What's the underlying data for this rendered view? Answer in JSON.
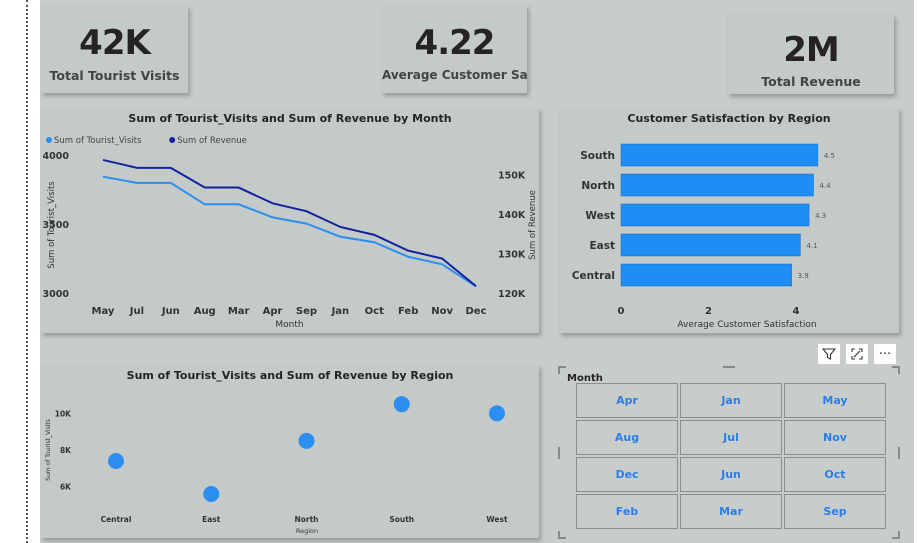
{
  "kpis": [
    {
      "value": "42K",
      "label": "Total Tourist Visits"
    },
    {
      "value": "4.22",
      "label": "Average Customer Sat..."
    },
    {
      "value": "2M",
      "label": "Total Revenue"
    }
  ],
  "chart_data": [
    {
      "type": "line",
      "title": "Sum of Tourist_Visits and Sum of Revenue by Month",
      "xlabel": "Month",
      "ylabel": "Sum of Tourist_Visits",
      "y2label": "Sum of Revenue",
      "x": [
        "May",
        "Jul",
        "Jun",
        "Aug",
        "Mar",
        "Apr",
        "Sep",
        "Jan",
        "Oct",
        "Feb",
        "Nov",
        "Dec"
      ],
      "ylim": [
        3000,
        4000
      ],
      "y2lim": [
        120000,
        155000
      ],
      "yticks": [
        "4000",
        "3500",
        "3000"
      ],
      "y2ticks": [
        "150K",
        "140K",
        "130K",
        "120K"
      ],
      "legend_position": "top-left",
      "series": [
        {
          "name": "Sum of Tourist_Visits",
          "axis": "left",
          "color": "#2b8ef0",
          "values": [
            3850,
            3805,
            3805,
            3650,
            3650,
            3555,
            3510,
            3415,
            3375,
            3270,
            3215,
            3055
          ]
        },
        {
          "name": "Sum of Revenue",
          "axis": "right",
          "color": "#12239e",
          "values": [
            154000,
            152000,
            152000,
            147000,
            147000,
            143000,
            141000,
            137000,
            135000,
            131000,
            129000,
            122000
          ]
        }
      ]
    },
    {
      "type": "bar",
      "orientation": "horizontal",
      "title": "Customer Satisfaction by Region",
      "xlabel": "Average Customer Satisfaction",
      "categories": [
        "South",
        "North",
        "West",
        "East",
        "Central"
      ],
      "values": [
        4.5,
        4.4,
        4.3,
        4.1,
        3.9
      ],
      "data_labels": [
        "4.5",
        "4.4",
        "4.3",
        "4.1",
        "3.9"
      ],
      "xlim": [
        0,
        4.8
      ],
      "xticks": [
        "0",
        "2",
        "4"
      ],
      "color": "#1e8ef5"
    },
    {
      "type": "scatter",
      "title": "Sum of Tourist_Visits and Sum of Revenue by Region",
      "xlabel": "Region",
      "ylabel": "Sum of Tourist_Visits",
      "categories": [
        "Central",
        "East",
        "North",
        "South",
        "West"
      ],
      "values": [
        7400,
        5600,
        8500,
        10500,
        10000
      ],
      "ylim": [
        5000,
        11000
      ],
      "yticks": [
        "10K",
        "8K",
        "6K"
      ],
      "color": "#2b8ef0"
    }
  ],
  "slicer": {
    "title": "Month",
    "items": [
      "Apr",
      "Jan",
      "May",
      "Aug",
      "Jul",
      "Nov",
      "Dec",
      "Jun",
      "Oct",
      "Feb",
      "Mar",
      "Sep"
    ]
  },
  "toolbar": {
    "filter_icon": "funnel-icon",
    "focus_icon": "expand-icon",
    "more_icon": "more-options-icon",
    "more_label": "···"
  }
}
